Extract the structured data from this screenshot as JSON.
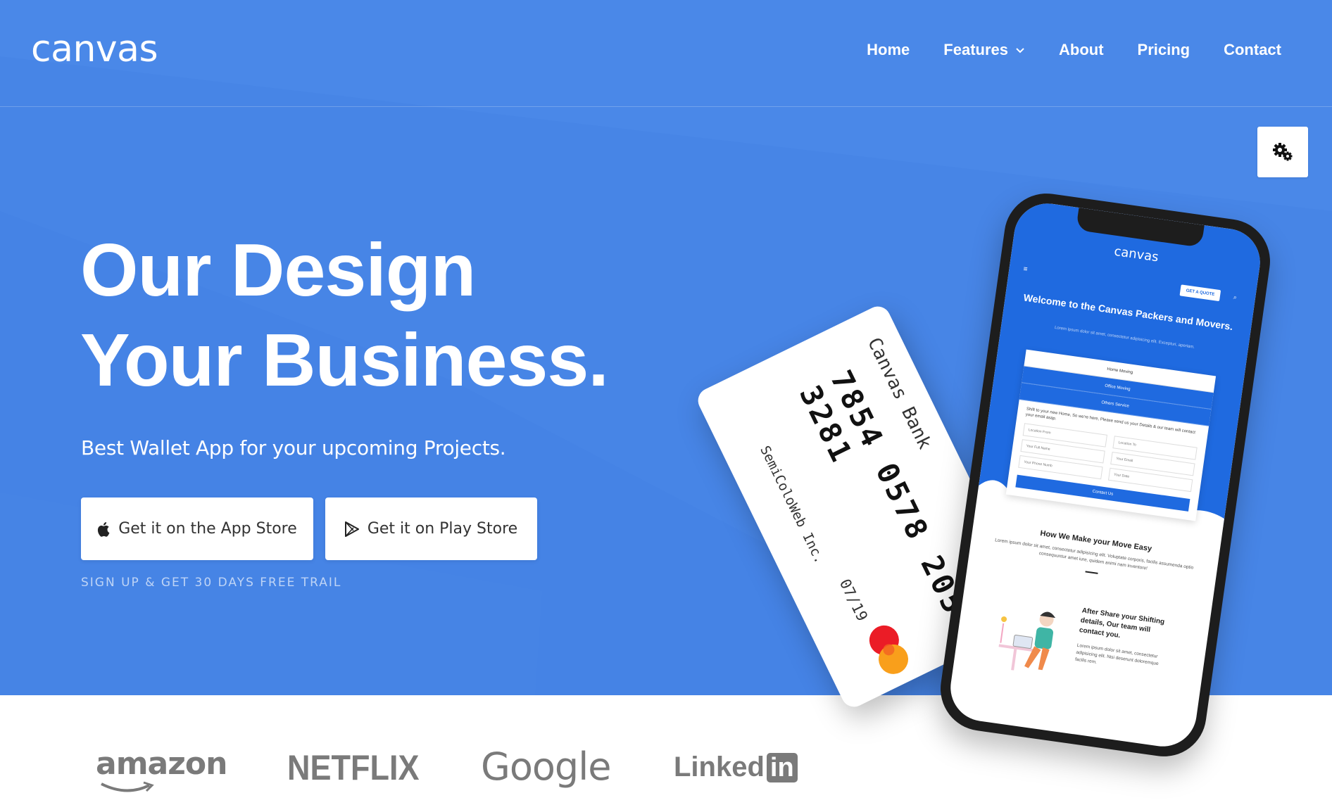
{
  "header": {
    "logo": "canvas",
    "nav": [
      {
        "label": "Home"
      },
      {
        "label": "Features",
        "has_dropdown": true
      },
      {
        "label": "About"
      },
      {
        "label": "Pricing"
      },
      {
        "label": "Contact"
      }
    ]
  },
  "hero": {
    "headline_line1": "Our Design",
    "headline_line2": "Your Business.",
    "subtitle": "Best Wallet App for your upcoming Projects.",
    "app_store_label": "Get it on the App Store",
    "play_store_label": "Get it on Play Store",
    "trail_text": "SIGN UP & GET 30 DAYS FREE TRAIL"
  },
  "card": {
    "bank": "Canvas Bank",
    "number": "7854 0578 2054 3281",
    "holder": "SemiColoWeb Inc.",
    "expiry": "07/19",
    "network": "MasterCard"
  },
  "phone": {
    "logo": "canvas",
    "quote_button": "GET A QUOTE",
    "title": "Welcome to the Canvas Packers and Movers.",
    "desc": "Lorem ipsum dolor sit amet, consectetur adipisicing elit. Excepturi, aperiam.",
    "tabs": [
      "Home Moving",
      "Office Moving",
      "Others Service"
    ],
    "form_text": "Shift to your new Home, So we're here, Please send us your Details & our team will contact your email asap.",
    "fields": [
      "Location From",
      "Location To",
      "Your Full Name",
      "Your Email",
      "Your Phone Numb",
      "Your Date"
    ],
    "submit": "Contact Us",
    "how_title": "How We Make your Move Easy",
    "how_text": "Lorem ipsum dolor sit amet, consectetur adipisicing elit. Voluptate corporis, facilis assumenda optio consequuntur amet iure, quidem animi nam inventore!",
    "share_title": "After Share your Shifting details, Our team will contact you.",
    "share_text": "Lorem ipsum dolor sit amet, consectetur adipisicing elit. Nisi deserunt doloremque facilis rem."
  },
  "brands": [
    "amazon",
    "NETFLIX",
    "Google",
    "Linked",
    "in"
  ],
  "colors": {
    "hero_bg": "#4785e6",
    "phone_accent": "#1f6ae0",
    "brand_gray": "#7a7a7a"
  },
  "icons": {
    "settings": "gears-icon",
    "app_store": "apple-icon",
    "play_store": "play-store-icon"
  }
}
